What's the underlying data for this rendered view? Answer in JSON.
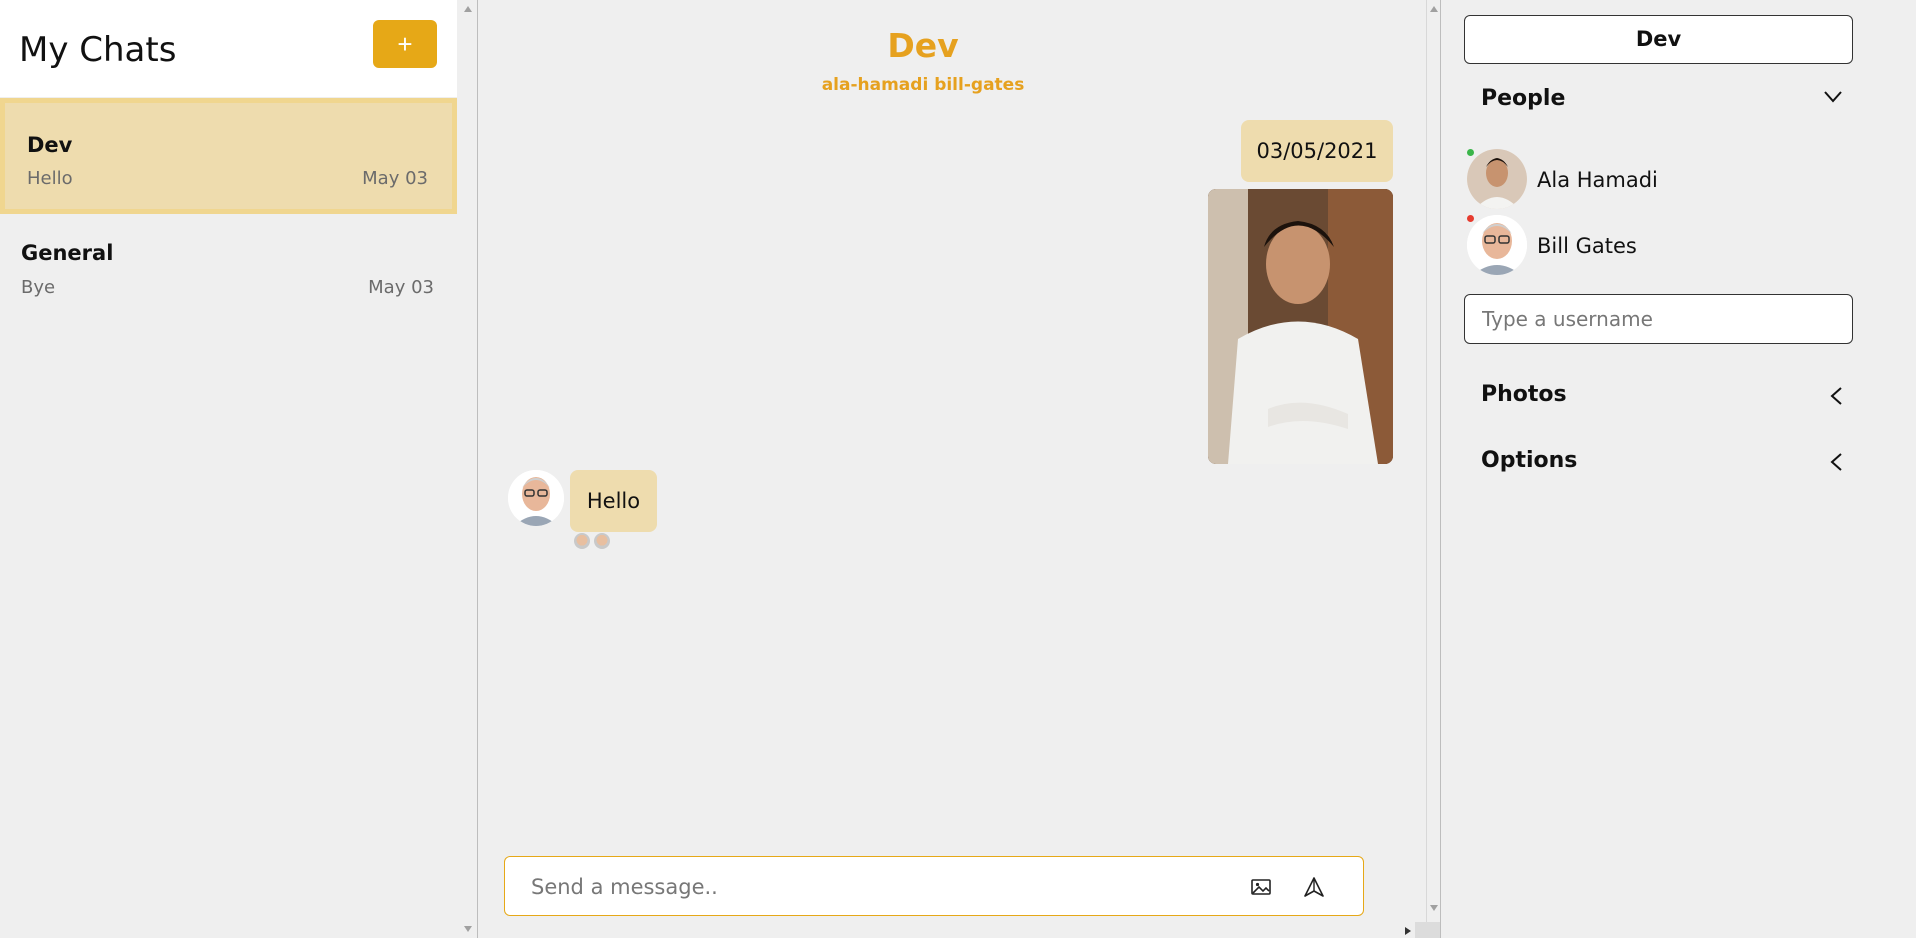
{
  "sidebar": {
    "title": "My Chats",
    "new_chat_label": "+",
    "chats": [
      {
        "name": "Dev",
        "preview": "Hello",
        "date": "May 03"
      },
      {
        "name": "General",
        "preview": "Bye",
        "date": "May 03"
      }
    ]
  },
  "chat": {
    "title": "Dev",
    "subtitle": "ala-hamadi bill-gates",
    "messages": {
      "date_bubble": "03/05/2021",
      "hello_text": "Hello"
    },
    "composer": {
      "placeholder": "Send a message.."
    }
  },
  "settings": {
    "room_name": "Dev",
    "people_label": "People",
    "people": [
      {
        "name": "Ala Hamadi",
        "status_color": "#3bb54a"
      },
      {
        "name": "Bill Gates",
        "status_color": "#e63b2e"
      }
    ],
    "username_placeholder": "Type a username",
    "photos_label": "Photos",
    "options_label": "Options"
  },
  "colors": {
    "accent": "#e6a817",
    "selected_chat": "#eedcae",
    "title_gold": "#e6a11f"
  }
}
